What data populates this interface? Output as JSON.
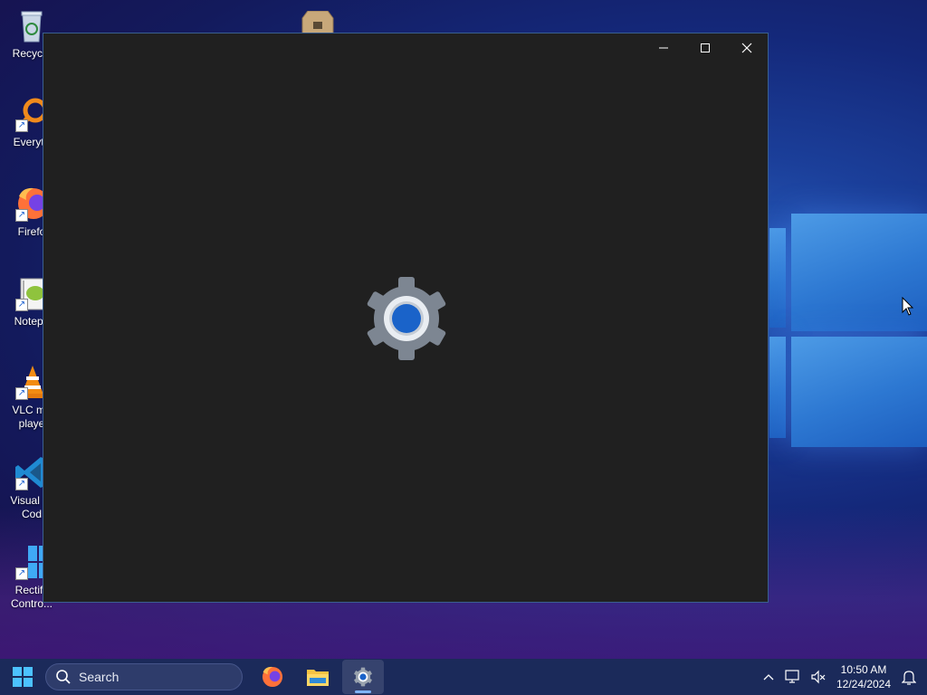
{
  "desktop": {
    "icons": [
      {
        "label": "Recycle",
        "icon": "recycle-bin-icon"
      },
      {
        "label": "Everyth",
        "icon": "everything-search-icon"
      },
      {
        "label": "Firefo",
        "icon": "firefox-icon"
      },
      {
        "label": "Notepa",
        "icon": "notepad-plus-plus-icon"
      },
      {
        "label": "VLC me",
        "label2": "playe",
        "icon": "vlc-icon"
      },
      {
        "label": "Visual St",
        "label2": "Cod",
        "icon": "vscode-icon"
      },
      {
        "label": "Rectify",
        "label2": "Contro...",
        "icon": "rectify-control-panel-icon"
      }
    ]
  },
  "window": {
    "app": "Settings",
    "splash_icon": "settings-gear-icon",
    "controls": {
      "minimize": "minimize-icon",
      "maximize": "maximize-icon",
      "close": "close-icon"
    }
  },
  "taskbar": {
    "start_icon": "windows-start-icon",
    "search_placeholder": "Search",
    "apps": [
      {
        "name": "Firefox",
        "icon": "firefox-icon"
      },
      {
        "name": "File Explorer",
        "icon": "file-explorer-icon"
      },
      {
        "name": "Settings",
        "icon": "settings-gear-icon",
        "active": true
      }
    ],
    "tray": {
      "chevron_icon": "chevron-up-icon",
      "network_icon": "network-icon",
      "volume_icon": "volume-muted-icon",
      "time": "10:50 AM",
      "date": "12/24/2024",
      "notification_icon": "notification-bell-icon"
    }
  },
  "colors": {
    "window_bg": "#202020",
    "accent": "#1a63c9",
    "taskbar": "#1b2a5a"
  }
}
